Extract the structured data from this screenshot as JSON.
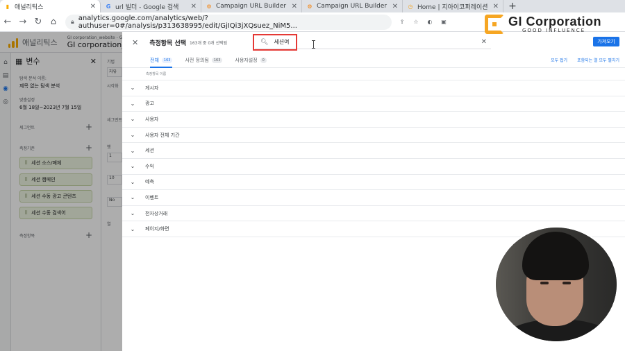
{
  "browser": {
    "tabs": [
      {
        "label": "애널리틱스",
        "icon": "analytics-icon",
        "active": true
      },
      {
        "label": "url 빌더 - Google 검색",
        "icon": "google-icon",
        "active": false
      },
      {
        "label": "Campaign URL Builder",
        "icon": "campaign-icon",
        "active": false
      },
      {
        "label": "Campaign URL Builder",
        "icon": "campaign-icon",
        "active": false
      },
      {
        "label": "Home | 지아이코퍼레이션",
        "icon": "home-icon",
        "active": false
      }
    ],
    "new_tab": "+",
    "url": "analytics.google.com/analytics/web/?authuser=0#/analysis/p313638995/edit/GjIQi3jXQsuez_NiM5..."
  },
  "overlay_logo": {
    "name": "GI Corporation",
    "tagline": "GOOD INFLUENCE",
    "accent": "#f6a623"
  },
  "ga": {
    "app_title": "애널리틱스",
    "account_small": "GI corporation_website - GA4",
    "account_name": "GI corporation_w",
    "variables_panel": {
      "title": "변수",
      "exploration_name_label": "탐색 분석 이름:",
      "exploration_name": "제목 없는 탐색 분석",
      "date_label": "맞춤설정",
      "date_range": "6월 18일~2023년 7월 15일",
      "segments_label": "세그먼트",
      "dimensions_label": "측정기준",
      "dimension_chips": [
        "세션 소스/매체",
        "세션 캠페인",
        "세션 수동 광고 콘텐츠",
        "세션 수동 검색어"
      ],
      "metrics_label": "측정항목"
    },
    "settings_panel": {
      "labels": [
        "기법",
        "시각화",
        "세그먼트",
        "행",
        "열"
      ],
      "values": [
        "자유",
        "1",
        "10",
        "No"
      ]
    }
  },
  "dialog": {
    "title": "측정항목 선택",
    "count_text": "163개 중 0개 선택됨",
    "search_value": "세션여",
    "apply_label": "가져오기",
    "tabs": [
      {
        "label": "전체",
        "badge": "163",
        "active": true
      },
      {
        "label": "사전 정의됨",
        "badge": "163",
        "active": false
      },
      {
        "label": "사용자설정",
        "badge": "0",
        "active": false
      }
    ],
    "collapse_all": "모두 접기",
    "expand_included": "포함되는 열 모두 펼치기",
    "column_header": "측정항목 이름",
    "categories": [
      "게시자",
      "광고",
      "사용자",
      "사용자 전체 기간",
      "세션",
      "수익",
      "예측",
      "이벤트",
      "전자상거래",
      "페이지/화면"
    ]
  },
  "colors": {
    "accent_blue": "#1a73e8",
    "highlight_red": "#e53935",
    "chip_green": "#eef5e2"
  }
}
